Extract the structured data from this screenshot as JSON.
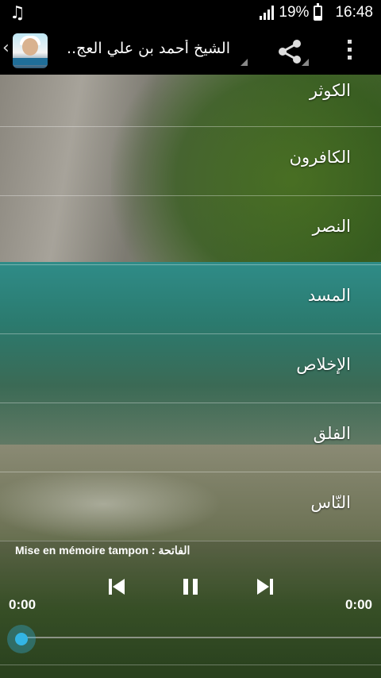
{
  "status_bar": {
    "battery": "19%",
    "time": "16:48"
  },
  "action_bar": {
    "title": "الشيخ أحمد بن علي العج.."
  },
  "surahs": [
    "الكوثر",
    "الكافرون",
    "النصر",
    "المسد",
    "الإخلاص",
    "الفلق",
    "النّاس"
  ],
  "player": {
    "buffer_prefix": "Mise en mémoire tampon : ",
    "current_track": "الفاتحة",
    "time_elapsed": "0:00",
    "time_total": "0:00",
    "progress": 0
  },
  "colors": {
    "accent": "#33b5e5",
    "bar_bg": "#000000"
  },
  "icons": [
    "music-note-icon",
    "signal-icon",
    "battery-icon",
    "back-chevron-icon",
    "share-icon",
    "overflow-menu-icon",
    "previous-icon",
    "pause-icon",
    "next-icon"
  ]
}
